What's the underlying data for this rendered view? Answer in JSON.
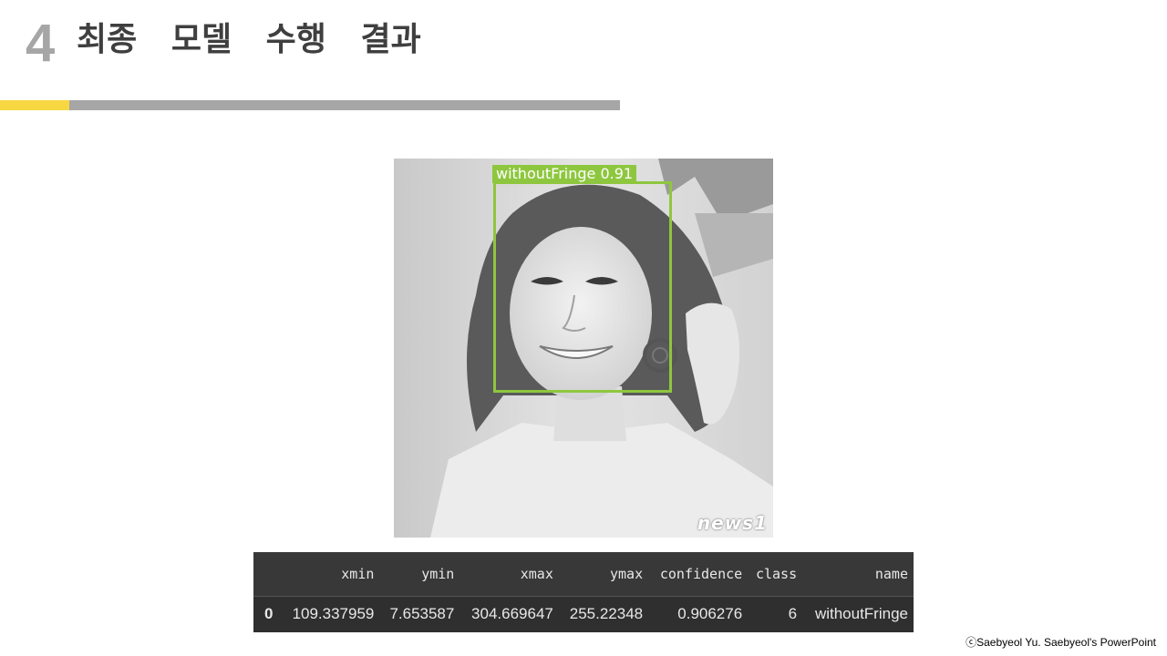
{
  "slide": {
    "number": "4",
    "title": "최종   모델   수행   결과"
  },
  "colors": {
    "accent": "#f7d842",
    "line": "#a6a6a6",
    "bbox": "#8ec73f",
    "table_bg": "#383838"
  },
  "detection_image": {
    "label": "withoutFringe 0.91",
    "watermark": "news1"
  },
  "results_table": {
    "columns": [
      "",
      "xmin",
      "ymin",
      "xmax",
      "ymax",
      "confidence",
      "class",
      "name"
    ],
    "rows": [
      [
        "0",
        "109.337959",
        "7.653587",
        "304.669647",
        "255.22348",
        "0.906276",
        "6",
        "withoutFringe"
      ]
    ]
  },
  "footer": {
    "copyright": "ⓒSaebyeol Yu.  Saebyeol's PowerPoint"
  }
}
